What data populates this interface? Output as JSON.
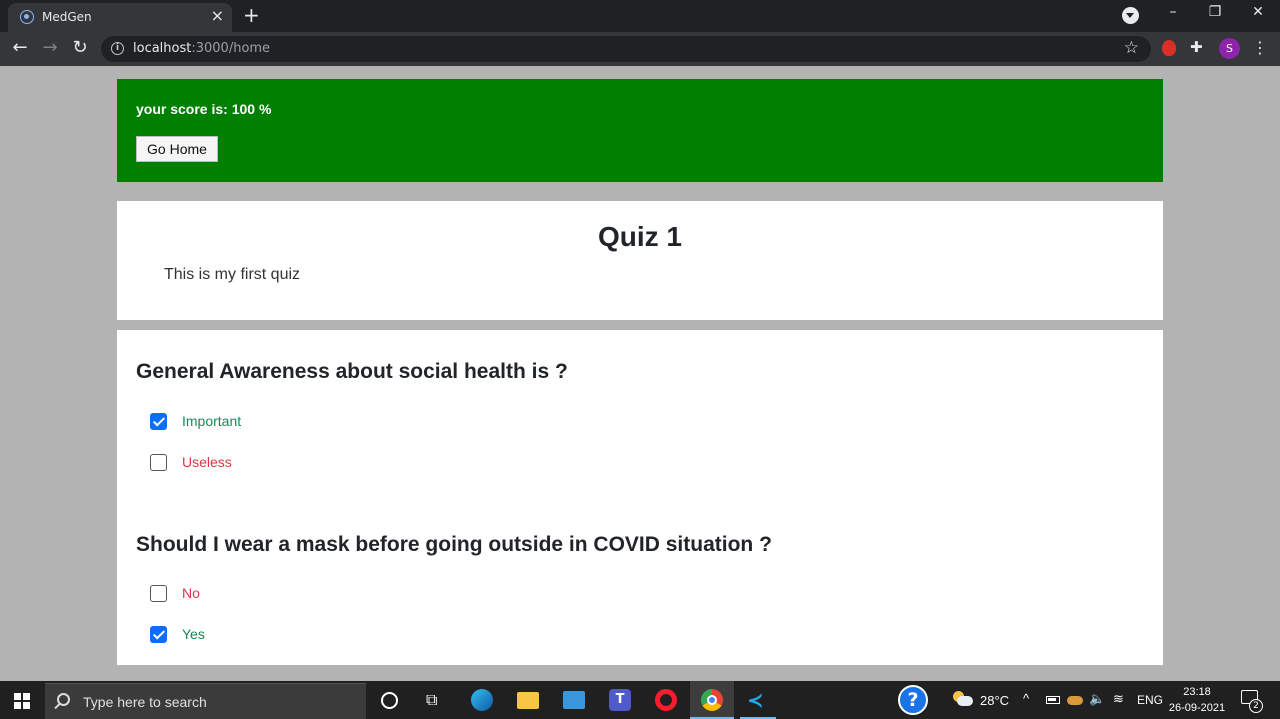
{
  "browser": {
    "tab_title": "MedGen",
    "tab_close": "×",
    "new_tab": "+",
    "url_host": "localhost",
    "url_path": ":3000/home",
    "avatar_letter": "S",
    "controls": {
      "minimize": "–",
      "maximize": "❐",
      "close": "✕"
    }
  },
  "result": {
    "score_text": "your score is: 100 %",
    "go_home_label": "Go Home",
    "background_color": "#008000"
  },
  "quiz": {
    "title": "Quiz 1",
    "description": "This is my first quiz"
  },
  "questions": [
    {
      "text": "General Awareness about social health is ?",
      "options": [
        {
          "label": "Important",
          "checked": true,
          "status": "correct"
        },
        {
          "label": "Useless",
          "checked": false,
          "status": "wrong"
        }
      ]
    },
    {
      "text": "Should I wear a mask before going outside in COVID situation ?",
      "options": [
        {
          "label": "No",
          "checked": false,
          "status": "wrong"
        },
        {
          "label": "Yes",
          "checked": true,
          "status": "correct"
        }
      ]
    }
  ],
  "colors": {
    "correct": "#198754",
    "wrong": "#dc3545",
    "checkbox": "#0d6efd"
  },
  "taskbar": {
    "search_placeholder": "Type here to search",
    "temperature": "28°C",
    "language": "ENG",
    "time": "23:18",
    "date": "26-09-2021",
    "notification_count": "2",
    "help_label": "?",
    "teams_label": "T"
  }
}
